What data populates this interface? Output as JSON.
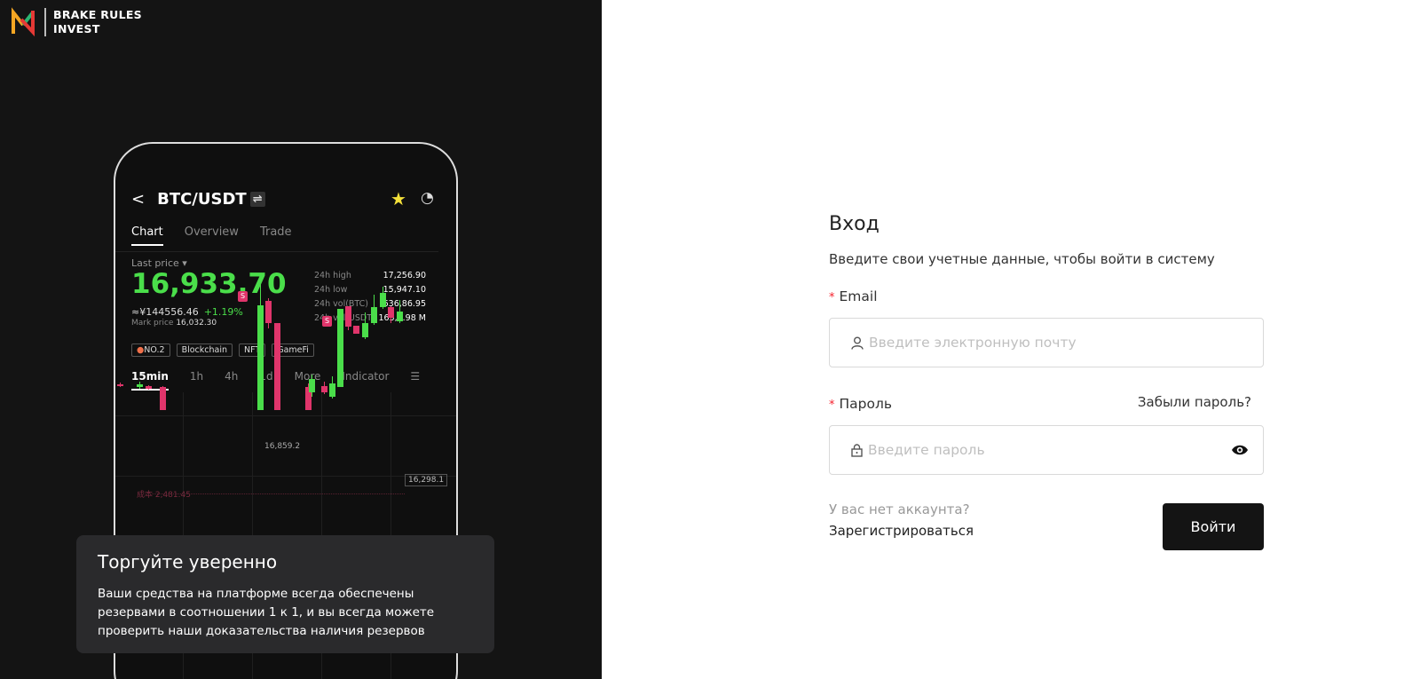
{
  "brand": {
    "name_line1": "BRAKE RULES",
    "name_line2": "INVEST"
  },
  "phone": {
    "pair": "BTC/USDT",
    "swap_icon": "⇌",
    "tabs": [
      "Chart",
      "Overview",
      "Trade"
    ],
    "last_price_label": "Last price ▾",
    "price": "16,933.70",
    "cny": "≈¥144556.46",
    "change": "+1.19%",
    "mark_label": "Mark price",
    "mark_value": "16,032.30",
    "stats": [
      [
        "24h high",
        "17,256.90"
      ],
      [
        "24h low",
        "15,947.10"
      ],
      [
        "24h vol(BTC)",
        "636,86.95"
      ],
      [
        "24h vol(USDT)",
        "163,7.98 M"
      ]
    ],
    "tags": [
      "NO.2",
      "Blockchain",
      "NFT",
      "GameFi"
    ],
    "timeframes": [
      "15min",
      "1h",
      "4h",
      "1d",
      "More",
      "Indicator"
    ],
    "chart_high_label": "16,859.2",
    "chart_last_label": "16,298.1",
    "cost_label": "成本 2,481.45",
    "s_badge": "S",
    "colors": {
      "up": "#4ade4a",
      "down": "#e0356b"
    }
  },
  "promo": {
    "title": "Торгуйте уверенно",
    "text": "Ваши средства на платформе всегда обеспечены резервами в соотношении 1 к 1, и вы всегда можете проверить наши доказательства наличия резервов"
  },
  "login": {
    "title": "Вход",
    "subtitle": "Введите свои учетные данные, чтобы войти в систему",
    "email_label": "Email",
    "email_placeholder": "Введите электронную почту",
    "password_label": "Пароль",
    "password_placeholder": "Введите пароль",
    "required_mark": "*",
    "forgot": "Забыли пароль?",
    "no_account": "У вас нет аккаунта?",
    "register": "Зарегистрироваться",
    "submit": "Войти"
  }
}
